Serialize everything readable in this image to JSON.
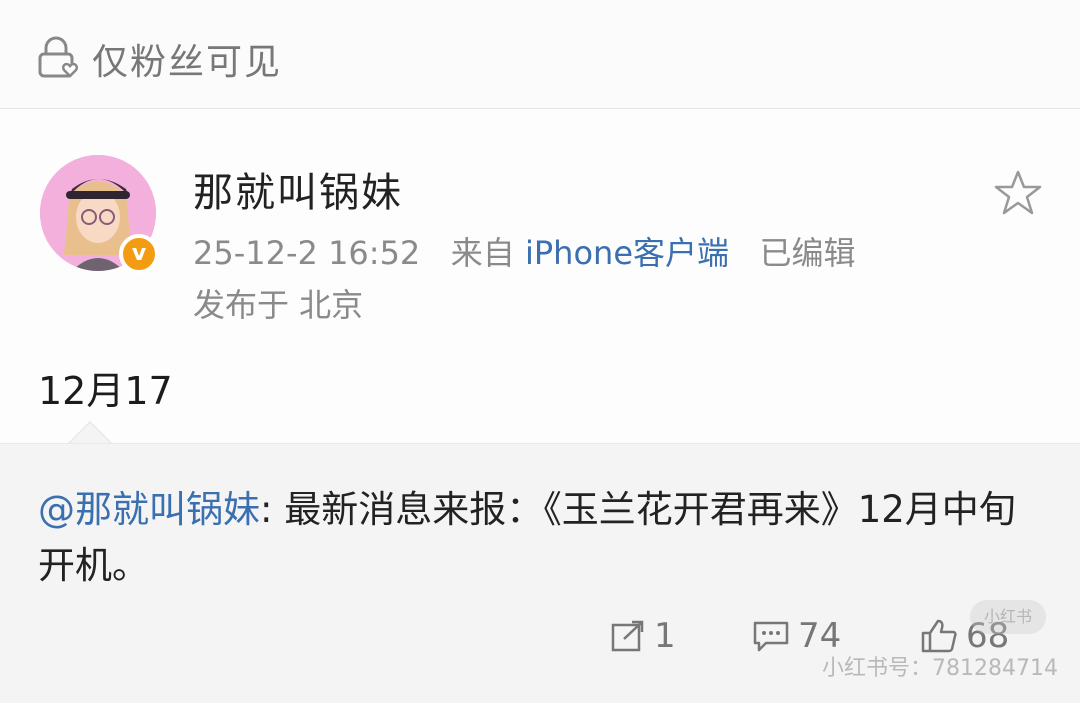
{
  "header": {
    "visibility_label": "仅粉丝可见"
  },
  "post": {
    "username": "那就叫锅妹",
    "verified_badge": "v",
    "timestamp": "25-12-2 16:52",
    "source_prefix": "来自",
    "source": "iPhone客户端",
    "edited": "已编辑",
    "location": "发布于 北京",
    "content": "12月17"
  },
  "repost": {
    "mention": "@那就叫锅妹",
    "text": ": 最新消息来报：《玉兰花开君再来》12月中旬开机。"
  },
  "actions": {
    "repost_count": "1",
    "comment_count": "74",
    "like_count": "68"
  },
  "watermark": {
    "badge": "小红书",
    "id": "小红书号：781284714"
  },
  "colors": {
    "link": "#3a6fb0",
    "badge": "#f39c12"
  }
}
